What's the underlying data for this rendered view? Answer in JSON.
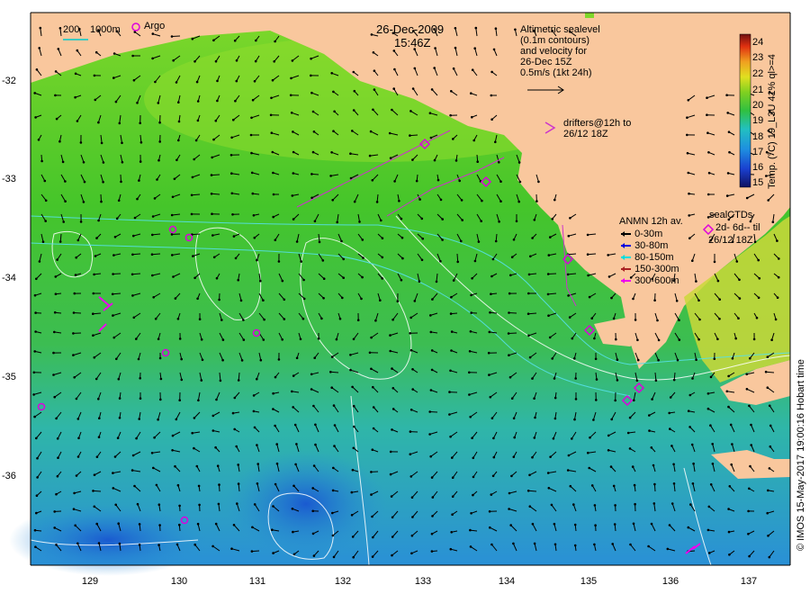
{
  "title": {
    "date": "26-Dec-2009",
    "time": "15:46Z"
  },
  "scale_bar": {
    "label_a": "200",
    "label_b": "1000m"
  },
  "argo_legend": {
    "label": "Argo"
  },
  "altimetry_note": {
    "lines": [
      "Altimetric sealevel",
      "(0.1m contours)",
      "and velocity for",
      "26-Dec 15Z",
      "0.5m/s (1kt 24h)"
    ]
  },
  "drifters_note": {
    "lines": [
      "drifters@12h to",
      "26/12 18Z"
    ]
  },
  "anmn_legend": {
    "title": "ANMN 12h av.",
    "items": [
      {
        "label": "0-30m",
        "color": "#000000"
      },
      {
        "label": "30-80m",
        "color": "#0000dd"
      },
      {
        "label": "80-150m",
        "color": "#00dddd"
      },
      {
        "label": "150-300m",
        "color": "#aa2222"
      },
      {
        "label": "300-600m",
        "color": "#ee00ee"
      }
    ]
  },
  "sealctd_legend": {
    "title": "sealCTDs",
    "lines": [
      "2d- 6d-- til",
      "26/12 18Z"
    ]
  },
  "colorbar": {
    "label": "Temp. (°C) 19_L3U 41% ql>=4",
    "ticks": [
      "15",
      "16",
      "17",
      "18",
      "19",
      "20",
      "21",
      "22",
      "23",
      "24"
    ]
  },
  "credit": "© IMOS 15-May-2017 19:00:16 Hobart time",
  "axes": {
    "x_ticks": [
      "129",
      "130",
      "131",
      "132",
      "133",
      "134",
      "135",
      "136",
      "137"
    ],
    "y_ticks": [
      "-32",
      "-33",
      "-34",
      "-35",
      "-36"
    ]
  },
  "colors": {
    "land": "#f9c79d",
    "sst_warm": "#44cc22",
    "sst_cool": "#22b0c8",
    "argo": "#dd00dd"
  }
}
